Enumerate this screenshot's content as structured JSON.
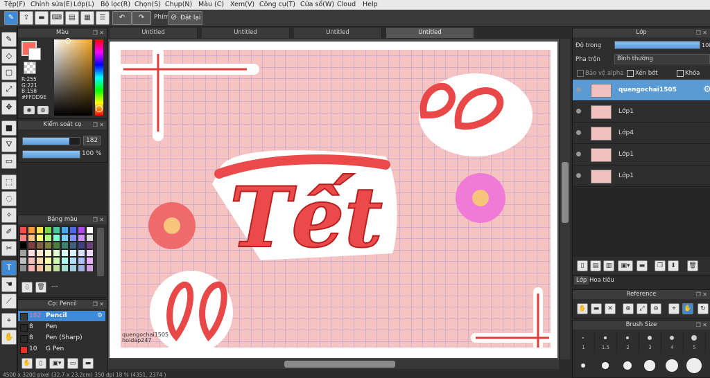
{
  "menu": [
    "Tệp(F)",
    "Chỉnh sửa(E)",
    "Lớp(L)",
    "Bộ lọc(R)",
    "Chọn(S)",
    "Chụp(N)",
    "Màu (C)",
    "Xem(V)",
    "Công cụ(T)",
    "Cửa sổ(W)",
    "Cloud",
    "Help"
  ],
  "toolbar": {
    "phim_label": "Phím",
    "reset_label": "Đặt lại"
  },
  "color_panel": {
    "title": "Màu",
    "r": "R:255",
    "g": "G:221",
    "b": "B:158",
    "hex": "#FFDD9E",
    "fg_color": "#ff6a5a",
    "bg_color": "#ffffff"
  },
  "brush_control": {
    "title": "Kiểm soát cọ",
    "size_value": "182",
    "size_fraction": 0.82,
    "opacity_value": "100 %",
    "opacity_fraction": 1.0
  },
  "palette": {
    "title": "Bảng màu",
    "name": "---",
    "colors": [
      "#ff4a4a",
      "#ff9a3a",
      "#ffe24a",
      "#7ad84a",
      "#4ac8a0",
      "#4aa8e8",
      "#4a6ae8",
      "#b04ae8",
      "#ffffff",
      "#ff8080",
      "#ffc080",
      "#ffff80",
      "#b0ff80",
      "#80ffd0",
      "#80d0ff",
      "#8090ff",
      "#d090ff",
      "#e0e0e0",
      "#000000",
      "#804040",
      "#806040",
      "#808040",
      "#508040",
      "#408070",
      "#406080",
      "#404080",
      "#704080",
      "#a0a0a0",
      "#ffe0e0",
      "#ffe8d0",
      "#ffffd8",
      "#e0ffd8",
      "#d8fff0",
      "#d8f0ff",
      "#d8e0ff",
      "#f0d8ff",
      "#c0c0c0",
      "#ffc0c0",
      "#ffd8b0",
      "#ffffb0",
      "#d0ffb0",
      "#b0fff0",
      "#b0e0ff",
      "#b0c0ff",
      "#e8b0ff",
      "#909090",
      "#ffb0b0",
      "#f0c0a0",
      "#e0e0a0",
      "#c0e0a0",
      "#a0e0d0",
      "#a0d0e0",
      "#a0b0e0",
      "#d0a0e0"
    ]
  },
  "brush_panel": {
    "title": "Cọ: Pencil",
    "brushes": [
      {
        "size": "182",
        "name": "Pencil",
        "color": "#3a3a3a",
        "selected": true
      },
      {
        "size": "8",
        "name": "Pen",
        "color": "#2a2a2a",
        "selected": false
      },
      {
        "size": "8",
        "name": "Pen (Sharp)",
        "color": "#2a2a2a",
        "selected": false
      },
      {
        "size": "10",
        "name": "G Pen",
        "color": "#ff2a2a",
        "selected": false
      }
    ]
  },
  "tabs": [
    "Untitled",
    "Untitled",
    "Untitled",
    "Untitled"
  ],
  "canvas": {
    "text1": "quengochai1505",
    "text2": "holdap247",
    "title_art": "Tết",
    "bg_color": "#f6c3c3",
    "grid_color": "#8888dd"
  },
  "status": "4500 x 3200 pixel  (32.7 x 23.2cm)  350 dpi  18 %  (4351, 2374 )",
  "layer_panel": {
    "title": "Lớp",
    "opacity_label": "Độ trong",
    "opacity_value": "100%",
    "opacity_fraction": 1.0,
    "blend_label": "Pha trộn",
    "blend_value": "Bình thường",
    "protect_alpha": "Bảo vệ alpha",
    "clip": "Xén bớt",
    "lock": "Khóa",
    "layers": [
      {
        "name": "quengochai1505",
        "selected": true
      },
      {
        "name": "Lớp1",
        "selected": false
      },
      {
        "name": "Lớp4",
        "selected": false
      },
      {
        "name": "Lớp1",
        "selected": false
      },
      {
        "name": "Lớp1",
        "selected": false
      }
    ],
    "tab_layers": "Lớp",
    "tab_pattern": "Hoa tiêu"
  },
  "reference_panel": {
    "title": "Reference"
  },
  "brush_size_panel": {
    "title": "Brush Size",
    "sizes": [
      "1",
      "1.5",
      "2",
      "3",
      "4",
      "5"
    ]
  }
}
